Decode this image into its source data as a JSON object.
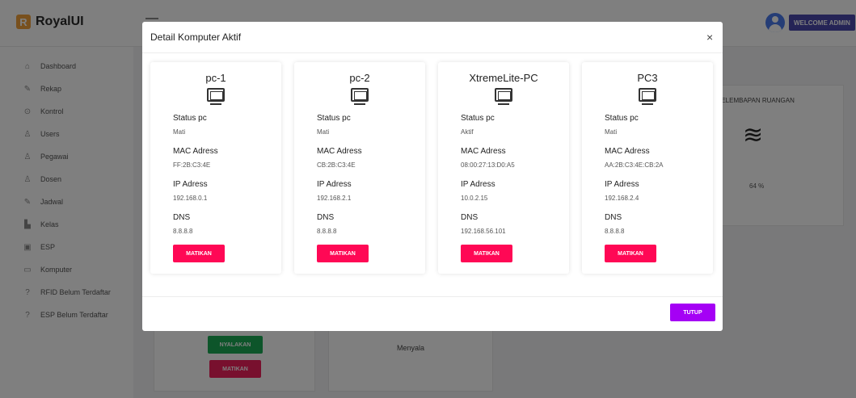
{
  "header": {
    "brand_letter": "R",
    "brand_name": "RoyalUI",
    "welcome_label": "WELCOME ADMIN"
  },
  "sidebar": {
    "items": [
      {
        "label": "Dashboard",
        "icon": "home-icon",
        "glyph": "⌂"
      },
      {
        "label": "Rekap",
        "icon": "edit-icon",
        "glyph": "✎"
      },
      {
        "label": "Kontrol",
        "icon": "location-icon",
        "glyph": "⊙"
      },
      {
        "label": "Users",
        "icon": "user-icon",
        "glyph": "♙"
      },
      {
        "label": "Pegawai",
        "icon": "user-icon",
        "glyph": "♙"
      },
      {
        "label": "Dosen",
        "icon": "user-icon",
        "glyph": "♙"
      },
      {
        "label": "Jadwal",
        "icon": "edit-icon",
        "glyph": "✎"
      },
      {
        "label": "Kelas",
        "icon": "building-icon",
        "glyph": "▙"
      },
      {
        "label": "ESP",
        "icon": "chip-icon",
        "glyph": "▣"
      },
      {
        "label": "Komputer",
        "icon": "monitor-icon",
        "glyph": "▭"
      },
      {
        "label": "RFID Belum Terdaftar",
        "icon": "question-icon",
        "glyph": "?"
      },
      {
        "label": "ESP Belum Terdaftar",
        "icon": "question-icon",
        "glyph": "?"
      }
    ]
  },
  "background": {
    "humidity_title": "KELEMBAPAN RUANGAN",
    "humidity_value": "64 %",
    "nyalakan_label": "NYALAKAN",
    "matikan_label": "MATIKAN",
    "menyala_text": "Menyala"
  },
  "modal": {
    "title": "Detail Komputer Aktif",
    "close_glyph": "×",
    "labels": {
      "status": "Status pc",
      "mac": "MAC Adress",
      "ip": "IP Adress",
      "dns": "DNS"
    },
    "pcs": [
      {
        "name": "pc-1",
        "status": "Mati",
        "mac": "FF:2B:C3:4E",
        "ip": "192.168.0.1",
        "dns": "8.8.8.8",
        "button": "MATIKAN"
      },
      {
        "name": "pc-2",
        "status": "Mati",
        "mac": "CB:2B:C3:4E",
        "ip": "192.168.2.1",
        "dns": "8.8.8.8",
        "button": "MATIKAN"
      },
      {
        "name": "XtremeLite-PC",
        "status": "Aktif",
        "mac": "08:00:27:13:D0:A5",
        "ip": "10.0.2.15",
        "dns": "192.168.56.101",
        "button": "MATIKAN"
      },
      {
        "name": "PC3",
        "status": "Mati",
        "mac": "AA:2B:C3:4E:CB:2A",
        "ip": "192.168.2.4",
        "dns": "8.8.8.8",
        "button": "MATIKAN"
      }
    ],
    "close_button_label": "TUTUP"
  },
  "colors": {
    "accent": "#4b49ac",
    "danger": "#ff0855",
    "success": "#1aaa55",
    "close_button": "#a500f5"
  }
}
